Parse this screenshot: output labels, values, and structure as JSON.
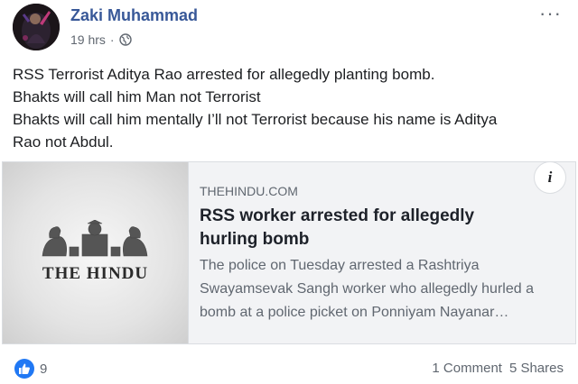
{
  "post": {
    "author": "Zaki Muhammad",
    "time": "19 hrs",
    "separator": "·",
    "privacy_icon": "globe-icon",
    "more_label": "···",
    "text_lines": [
      "RSS Terrorist Aditya Rao arrested for allegedly planting bomb.",
      "Bhakts will call him Man not Terrorist",
      "Bhakts will call him mentally I’ll not Terrorist because his name is Aditya",
      "Rao not Abdul."
    ]
  },
  "link_preview": {
    "thumbnail_logo_text": "THE HINDU",
    "info_label": "i",
    "domain": "THEHINDU.COM",
    "headline": "RSS worker arrested for allegedly hurling bomb",
    "description": "The police on Tuesday arrested a Rashtriya Swayamsevak Sangh worker who allegedly hurled a bomb at a police picket on Ponniyam Nayanar…"
  },
  "footer": {
    "like_count": "9",
    "comments": "1 Comment",
    "shares": "5 Shares"
  },
  "colors": {
    "author_link": "#385898",
    "like_blue": "#2078f4",
    "secondary_text": "#606770"
  }
}
